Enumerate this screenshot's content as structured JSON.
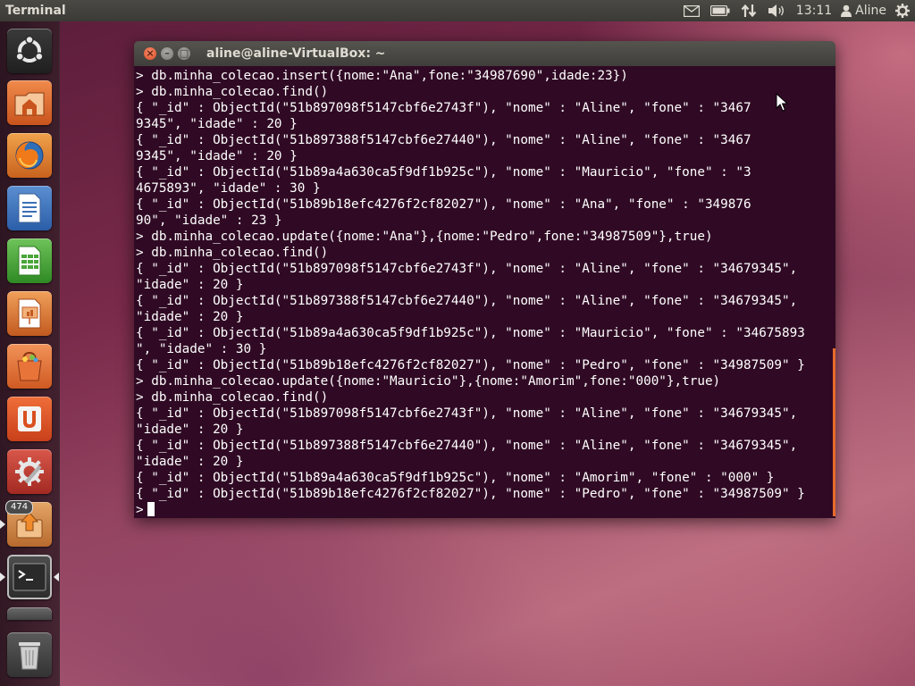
{
  "top_panel": {
    "app_title": "Terminal",
    "clock": "13:11",
    "user": "Aline"
  },
  "launcher": {
    "items": [
      {
        "name": "Dash Home",
        "icon": "ubuntu-logo-icon"
      },
      {
        "name": "Home Folder",
        "icon": "home-folder-icon"
      },
      {
        "name": "Firefox Web Browser",
        "icon": "firefox-icon"
      },
      {
        "name": "LibreOffice Writer",
        "icon": "writer-icon"
      },
      {
        "name": "LibreOffice Calc",
        "icon": "calc-icon"
      },
      {
        "name": "LibreOffice Impress",
        "icon": "impress-icon"
      },
      {
        "name": "Ubuntu Software Center",
        "icon": "software-center-icon"
      },
      {
        "name": "Ubuntu One",
        "icon": "ubuntu-one-icon"
      },
      {
        "name": "System Settings",
        "icon": "settings-icon"
      },
      {
        "name": "Update Manager",
        "icon": "update-manager-icon",
        "badge": "474"
      },
      {
        "name": "Terminal",
        "icon": "terminal-icon"
      },
      {
        "name": "Workspace Switcher",
        "icon": "workspace-icon"
      },
      {
        "name": "Trash",
        "icon": "trash-icon"
      }
    ]
  },
  "window": {
    "title": "aline@aline-VirtualBox: ~"
  },
  "terminal": {
    "lines": [
      "> db.minha_colecao.insert({nome:\"Ana\",fone:\"34987690\",idade:23})",
      "> db.minha_colecao.find()",
      "{ \"_id\" : ObjectId(\"51b897098f5147cbf6e2743f\"), \"nome\" : \"Aline\", \"fone\" : \"3467",
      "9345\", \"idade\" : 20 }",
      "{ \"_id\" : ObjectId(\"51b897388f5147cbf6e27440\"), \"nome\" : \"Aline\", \"fone\" : \"3467",
      "9345\", \"idade\" : 20 }",
      "{ \"_id\" : ObjectId(\"51b89a4a630ca5f9df1b925c\"), \"nome\" : \"Mauricio\", \"fone\" : \"3",
      "4675893\", \"idade\" : 30 }",
      "{ \"_id\" : ObjectId(\"51b89b18efc4276f2cf82027\"), \"nome\" : \"Ana\", \"fone\" : \"349876",
      "90\", \"idade\" : 23 }",
      "> db.minha_colecao.update({nome:\"Ana\"},{nome:\"Pedro\",fone:\"34987509\"},true)",
      "> db.minha_colecao.find()",
      "{ \"_id\" : ObjectId(\"51b897098f5147cbf6e2743f\"), \"nome\" : \"Aline\", \"fone\" : \"34679345\",",
      "\"idade\" : 20 }",
      "{ \"_id\" : ObjectId(\"51b897388f5147cbf6e27440\"), \"nome\" : \"Aline\", \"fone\" : \"34679345\",",
      "\"idade\" : 20 }",
      "{ \"_id\" : ObjectId(\"51b89a4a630ca5f9df1b925c\"), \"nome\" : \"Mauricio\", \"fone\" : \"34675893",
      "\", \"idade\" : 30 }",
      "{ \"_id\" : ObjectId(\"51b89b18efc4276f2cf82027\"), \"nome\" : \"Pedro\", \"fone\" : \"34987509\" }",
      "> db.minha_colecao.update({nome:\"Mauricio\"},{nome:\"Amorim\",fone:\"000\"},true)",
      "> db.minha_colecao.find()",
      "{ \"_id\" : ObjectId(\"51b897098f5147cbf6e2743f\"), \"nome\" : \"Aline\", \"fone\" : \"34679345\",",
      "\"idade\" : 20 }",
      "{ \"_id\" : ObjectId(\"51b897388f5147cbf6e27440\"), \"nome\" : \"Aline\", \"fone\" : \"34679345\",",
      "\"idade\" : 20 }",
      "{ \"_id\" : ObjectId(\"51b89a4a630ca5f9df1b925c\"), \"nome\" : \"Amorim\", \"fone\" : \"000\" }",
      "{ \"_id\" : ObjectId(\"51b89b18efc4276f2cf82027\"), \"nome\" : \"Pedro\", \"fone\" : \"34987509\" }"
    ],
    "prompt": ">"
  },
  "colors": {
    "terminal_bg": "#300a24",
    "terminal_fg": "#ffffff",
    "panel_bg": "#3c3b37",
    "close_button": "#df4a16"
  }
}
